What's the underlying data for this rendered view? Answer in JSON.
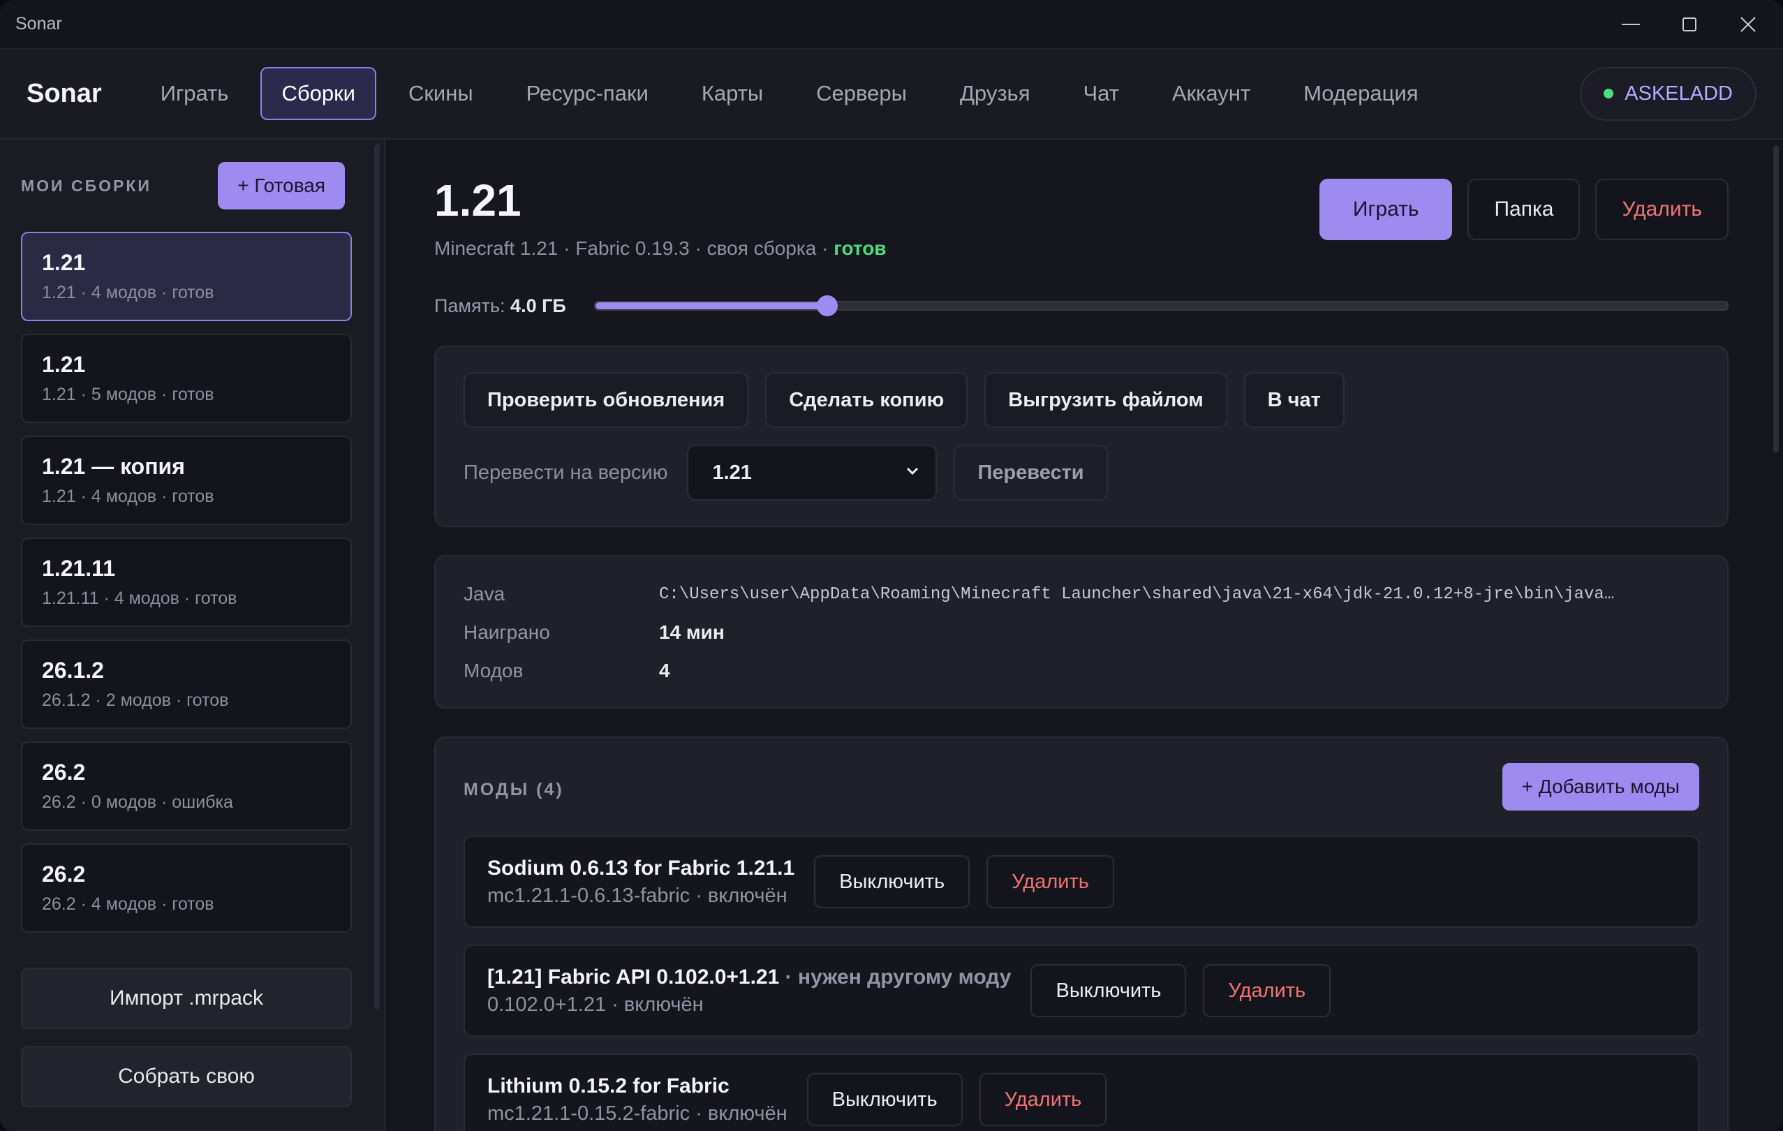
{
  "window": {
    "title": "Sonar"
  },
  "nav": {
    "logo": "Sonar",
    "items": [
      "Играть",
      "Сборки",
      "Скины",
      "Ресурс-паки",
      "Карты",
      "Серверы",
      "Друзья",
      "Чат",
      "Аккаунт",
      "Модерация"
    ],
    "active_index": 1,
    "user": "ASKELADD"
  },
  "sidebar": {
    "title": "МОИ СБОРКИ",
    "new_button": "+ Готовая",
    "builds": [
      {
        "name": "1.21",
        "meta": "1.21 · 4 модов · готов"
      },
      {
        "name": "1.21",
        "meta": "1.21 · 5 модов · готов"
      },
      {
        "name": "1.21 — копия",
        "meta": "1.21 · 4 модов · готов"
      },
      {
        "name": "1.21.11",
        "meta": "1.21.11 · 4 модов · готов"
      },
      {
        "name": "26.1.2",
        "meta": "26.1.2 · 2 модов · готов"
      },
      {
        "name": "26.2",
        "meta": "26.2 · 0 модов · ошибка"
      },
      {
        "name": "26.2",
        "meta": "26.2 · 4 модов · готов"
      }
    ],
    "import_button": "Импорт .mrpack",
    "build_own_button": "Собрать свою"
  },
  "build": {
    "title": "1.21",
    "subtitle": "Minecraft 1.21 · Fabric 0.19.3 · своя сборка · ",
    "status": "готов",
    "play_button": "Играть",
    "folder_button": "Папка",
    "delete_button": "Удалить",
    "memory_label": "Память: ",
    "memory_value": "4.0 ГБ",
    "memory_fraction": 0.205
  },
  "actions": {
    "check_updates": "Проверить обновления",
    "make_copy": "Сделать копию",
    "export_file": "Выгрузить файлом",
    "to_chat": "В чат",
    "convert_label": "Перевести на версию",
    "convert_version": "1.21",
    "convert_button": "Перевести"
  },
  "info": {
    "java_key": "Java",
    "java_value": "C:\\Users\\user\\AppData\\Roaming\\Minecraft Launcher\\shared\\java\\21-x64\\jdk-21.0.12+8-jre\\bin\\java…",
    "played_key": "Наиграно",
    "played_value": "14 мин",
    "mods_key": "Модов",
    "mods_value": "4"
  },
  "mods": {
    "title": "МОДЫ (4)",
    "add_button": "+ Добавить моды",
    "disable_label": "Выключить",
    "delete_label": "Удалить",
    "items": [
      {
        "name": "Sodium 0.6.13 for Fabric 1.21.1",
        "note": "",
        "meta": "mc1.21.1-0.6.13-fabric · включён"
      },
      {
        "name": "[1.21] Fabric API 0.102.0+1.21",
        "note": " · нужен другому моду",
        "meta": "0.102.0+1.21 · включён"
      },
      {
        "name": "Lithium 0.15.2 for Fabric",
        "note": "",
        "meta": "mc1.21.1-0.15.2-fabric · включён"
      }
    ]
  },
  "colors": {
    "accent": "#9e8bf0",
    "ok": "#4ade80",
    "danger": "#f07474"
  }
}
